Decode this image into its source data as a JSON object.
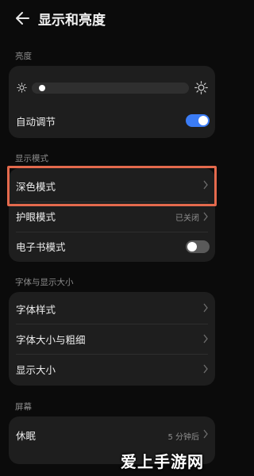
{
  "header": {
    "title": "显示和亮度"
  },
  "brightness": {
    "section_label": "亮度",
    "auto_adjust_label": "自动调节",
    "auto_adjust_on": true,
    "level": 0.03
  },
  "display_mode": {
    "section_label": "显示模式",
    "items": [
      {
        "label": "深色模式",
        "value": ""
      },
      {
        "label": "护眼模式",
        "value": "已关闭"
      },
      {
        "label": "电子书模式",
        "toggle_on": false
      }
    ]
  },
  "font": {
    "section_label": "字体与显示大小",
    "items": [
      {
        "label": "字体样式"
      },
      {
        "label": "字体大小与粗细"
      },
      {
        "label": "显示大小"
      }
    ]
  },
  "screen": {
    "section_label": "屏幕",
    "items": [
      {
        "label": "休眠",
        "value": "5 分钟后"
      }
    ]
  },
  "watermark": "爱上手游网",
  "colors": {
    "accent": "#3b7cf5",
    "highlight": "#e46a4d",
    "card": "#1e1e1e",
    "background": "#0b0b0b"
  }
}
